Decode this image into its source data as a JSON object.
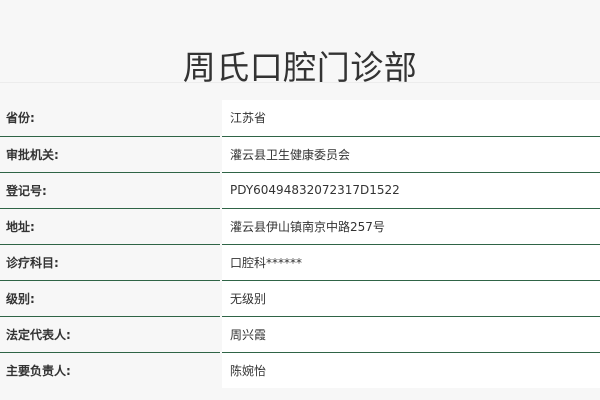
{
  "header": {
    "title": "周氏口腔门诊部"
  },
  "details": [
    {
      "label": "省份:",
      "value": "江苏省"
    },
    {
      "label": "审批机关:",
      "value": "灌云县卫生健康委员会"
    },
    {
      "label": "登记号:",
      "value": "PDY60494832072317D1522"
    },
    {
      "label": "地址:",
      "value": "灌云县伊山镇南京中路257号"
    },
    {
      "label": "诊疗科目:",
      "value": "口腔科******"
    },
    {
      "label": "级别:",
      "value": "无级别"
    },
    {
      "label": "法定代表人:",
      "value": "周兴霞"
    },
    {
      "label": "主要负责人:",
      "value": "陈婉怡"
    }
  ],
  "colors": {
    "background": "#f7f7f7",
    "value_background": "#ffffff",
    "divider": "#2f6446",
    "text": "#333333"
  }
}
